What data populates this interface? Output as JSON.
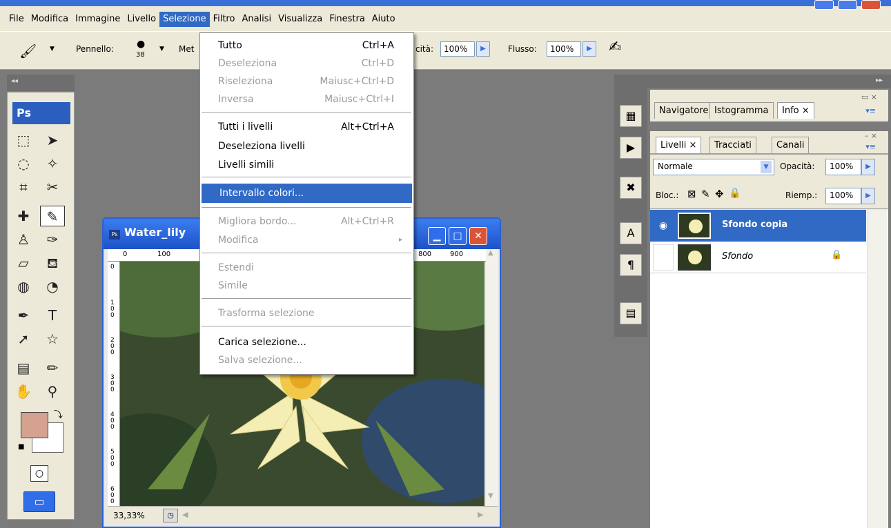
{
  "menubar": {
    "items": [
      "File",
      "Modifica",
      "Immagine",
      "Livello",
      "Selezione",
      "Filtro",
      "Analisi",
      "Visualizza",
      "Finestra",
      "Aiuto"
    ],
    "active_index": 4
  },
  "optionsbar": {
    "brush_label": "Pennello:",
    "brush_size": "38",
    "mode_partial": "Met",
    "opacity_partial": "cità:",
    "opacity_value": "100%",
    "flow_label": "Flusso:",
    "flow_value": "100%"
  },
  "toolbox": {
    "logo": "Ps",
    "colors": {
      "foreground": "#d4a28e",
      "background": "#ffffff"
    }
  },
  "document": {
    "title": "Water_lily",
    "ruler_top": [
      "0",
      "100",
      "800",
      "900"
    ],
    "ruler_left": [
      "0",
      "100",
      "200",
      "300",
      "400",
      "500",
      "600"
    ],
    "zoom": "33,33%"
  },
  "selection_menu": {
    "items": [
      {
        "label": "Tutto",
        "shortcut": "Ctrl+A",
        "disabled": false
      },
      {
        "label": "Deseleziona",
        "shortcut": "Ctrl+D",
        "disabled": true
      },
      {
        "label": "Riseleziona",
        "shortcut": "Maiusc+Ctrl+D",
        "disabled": true
      },
      {
        "label": "Inversa",
        "shortcut": "Maiusc+Ctrl+I",
        "disabled": true
      },
      {
        "label": "Tutti i livelli",
        "shortcut": "Alt+Ctrl+A",
        "disabled": false
      },
      {
        "label": "Deseleziona livelli",
        "shortcut": "",
        "disabled": false
      },
      {
        "label": "Livelli simili",
        "shortcut": "",
        "disabled": false
      },
      {
        "label": "Intervallo colori...",
        "shortcut": "",
        "disabled": false,
        "highlighted": true
      },
      {
        "label": "Migliora bordo...",
        "shortcut": "Alt+Ctrl+R",
        "disabled": true
      },
      {
        "label": "Modifica",
        "shortcut": "▸",
        "disabled": true
      },
      {
        "label": "Estendi",
        "shortcut": "",
        "disabled": true
      },
      {
        "label": "Simile",
        "shortcut": "",
        "disabled": true
      },
      {
        "label": "Trasforma selezione",
        "shortcut": "",
        "disabled": true
      },
      {
        "label": "Carica selezione...",
        "shortcut": "",
        "disabled": false
      },
      {
        "label": "Salva selezione...",
        "shortcut": "",
        "disabled": true
      }
    ]
  },
  "info_panel": {
    "tabs": [
      "Navigatore",
      "Istogramma",
      "Info"
    ]
  },
  "layers_panel": {
    "tabs": [
      "Livelli",
      "Tracciati",
      "Canali"
    ],
    "blend_mode": "Normale",
    "opacity_label": "Opacità:",
    "opacity_value": "100%",
    "lock_label": "Bloc.:",
    "fill_label": "Riemp.:",
    "fill_value": "100%",
    "layers": [
      {
        "name": "Sfondo copia",
        "visible": true,
        "selected": true
      },
      {
        "name": "Sfondo",
        "visible": false,
        "selected": false,
        "locked": true
      }
    ]
  }
}
